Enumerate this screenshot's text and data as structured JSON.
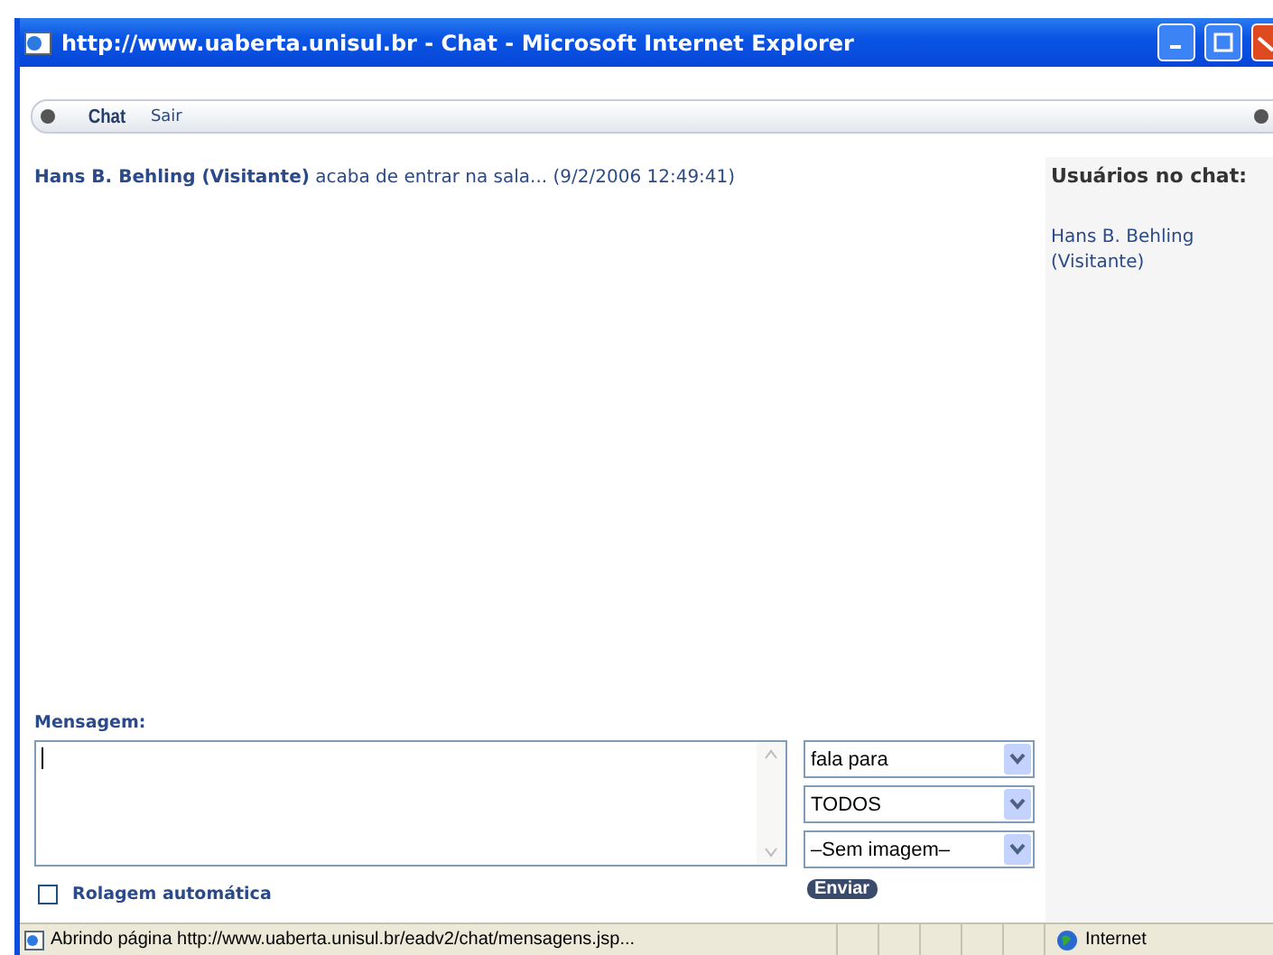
{
  "window": {
    "title": "http://www.uaberta.unisul.br - Chat - Microsoft Internet Explorer"
  },
  "toolbar": {
    "items": [
      {
        "label": "Chat",
        "selected": true
      },
      {
        "label": "Sair",
        "selected": false
      }
    ]
  },
  "messages": [
    "**Hans B. Behling (Visitante)** acaba de entrar na sala... (9/2/2006 12:49:41)"
  ],
  "users_panel": {
    "title": "Usuários no chat:",
    "users": [
      "Hans B. Behling (Visitante)"
    ]
  },
  "compose": {
    "label": "Mensagem:",
    "selects": [
      {
        "value": "fala para"
      },
      {
        "value": "TODOS"
      },
      {
        "value": "–Sem imagem–"
      }
    ],
    "auto_scroll": {
      "label": "Rolagem automática",
      "checked": false
    },
    "send_button": "Enviar"
  },
  "status_bar": {
    "text": "Abrindo página http://www.uaberta.unisul.br/eadv2/chat/mensagens.jsp...",
    "zone": "Internet"
  }
}
